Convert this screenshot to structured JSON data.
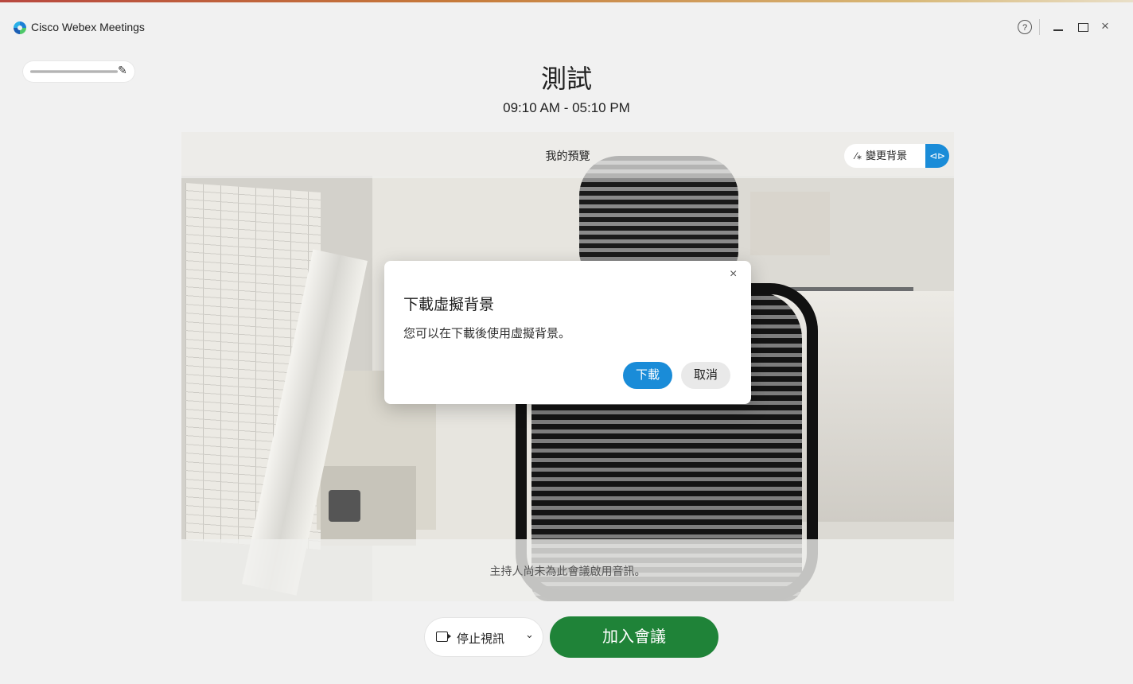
{
  "window": {
    "app_title": "Cisco Webex Meetings",
    "help_glyph": "?",
    "close_glyph": "×"
  },
  "user": {
    "edit_icon": "✎"
  },
  "meeting": {
    "title": "測試",
    "time": "09:10 AM - 05:10 PM"
  },
  "preview": {
    "label": "我的預覽",
    "change_background_label": "變更背景",
    "change_background_icon": "magic-wand-icon",
    "mirror_icon": "mirror-icon",
    "mirror_glyph": "⊲⊳",
    "audio_notice": "主持人尚未為此會議啟用音訊。"
  },
  "dialog": {
    "title": "下載虛擬背景",
    "message": "您可以在下載後使用虛擬背景。",
    "download_label": "下載",
    "cancel_label": "取消",
    "close_glyph": "×"
  },
  "controls": {
    "video_label": "停止視訊",
    "chevron_glyph": "⌄",
    "join_label": "加入會議"
  },
  "colors": {
    "accent_blue": "#1a8cd8",
    "join_green": "#1f8338"
  }
}
